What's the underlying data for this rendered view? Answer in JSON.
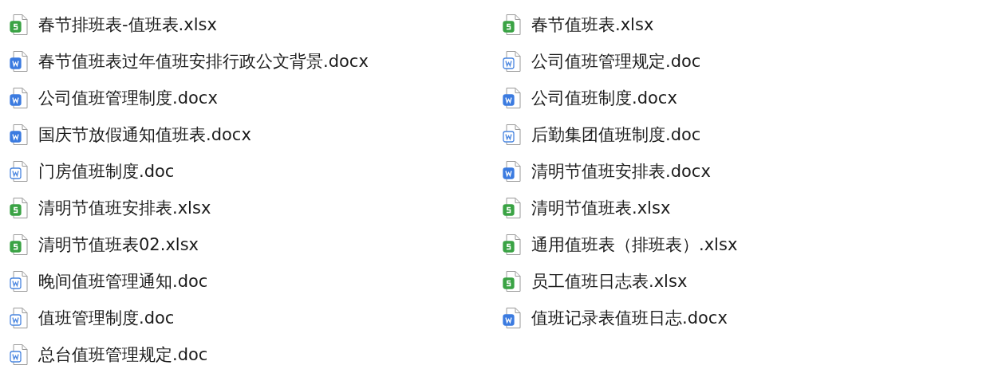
{
  "columns": [
    {
      "files": [
        {
          "name": "春节排班表-值班表.xlsx",
          "kind": "sheet"
        },
        {
          "name": "春节值班表过年值班安排行政公文背景.docx",
          "kind": "word"
        },
        {
          "name": "公司值班管理制度.docx",
          "kind": "word"
        },
        {
          "name": "国庆节放假通知值班表.docx",
          "kind": "word"
        },
        {
          "name": "门房值班制度.doc",
          "kind": "word-legacy"
        },
        {
          "name": "清明节值班安排表.xlsx",
          "kind": "sheet"
        },
        {
          "name": "清明节值班表02.xlsx",
          "kind": "sheet"
        },
        {
          "name": "晚间值班管理通知.doc",
          "kind": "word-legacy"
        },
        {
          "name": "值班管理制度.doc",
          "kind": "word-legacy"
        },
        {
          "name": "总台值班管理规定.doc",
          "kind": "word-legacy"
        }
      ]
    },
    {
      "files": [
        {
          "name": "春节值班表.xlsx",
          "kind": "sheet"
        },
        {
          "name": "公司值班管理规定.doc",
          "kind": "word-legacy"
        },
        {
          "name": "公司值班制度.docx",
          "kind": "word"
        },
        {
          "name": "后勤集团值班制度.doc",
          "kind": "word-legacy"
        },
        {
          "name": "清明节值班安排表.docx",
          "kind": "word"
        },
        {
          "name": "清明节值班表.xlsx",
          "kind": "sheet"
        },
        {
          "name": "通用值班表（排班表）.xlsx",
          "kind": "sheet"
        },
        {
          "name": "员工值班日志表.xlsx",
          "kind": "sheet"
        },
        {
          "name": "值班记录表值班日志.docx",
          "kind": "word"
        }
      ]
    }
  ]
}
